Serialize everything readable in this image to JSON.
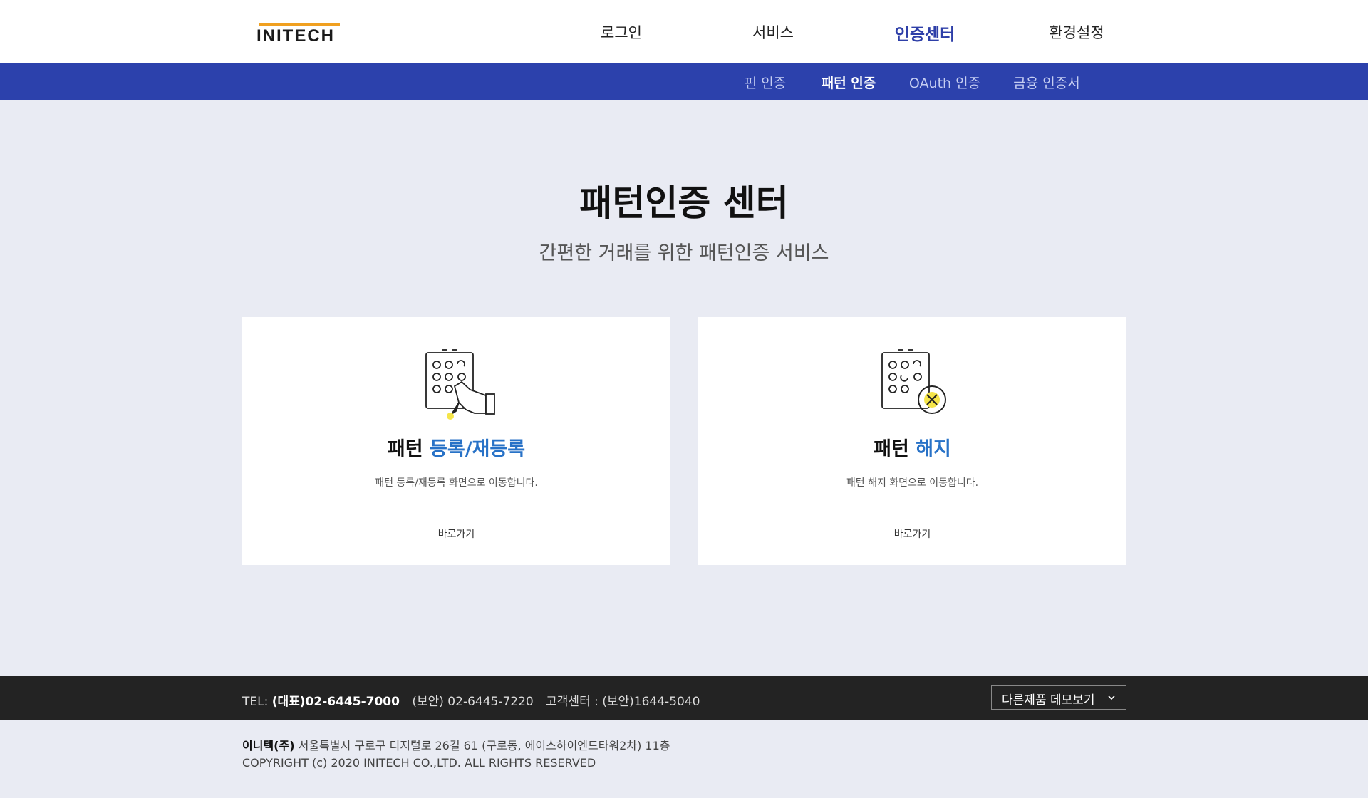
{
  "header": {
    "logo_text": "INITECH",
    "nav": [
      {
        "label": "로그인"
      },
      {
        "label": "서비스"
      },
      {
        "label": "인증센터",
        "active": true
      },
      {
        "label": "환경설정"
      }
    ]
  },
  "subnav": [
    {
      "label": "핀 인증"
    },
    {
      "label": "패턴 인증",
      "active": true
    },
    {
      "label": "OAuth 인증"
    },
    {
      "label": "금융 인증서"
    }
  ],
  "hero": {
    "title": "패턴인증 센터",
    "subtitle": "간편한 거래를 위한 패턴인증 서비스"
  },
  "cards": [
    {
      "title_prefix": "패턴",
      "title_accent": "등록/재등록",
      "description": "패턴 등록/재등록 화면으로 이동합니다.",
      "link": "바로가기",
      "icon": "pattern-register-icon"
    },
    {
      "title_prefix": "패턴",
      "title_accent": "해지",
      "description": "패턴 해지 화면으로 이동합니다.",
      "link": "바로가기",
      "icon": "pattern-cancel-icon"
    }
  ],
  "footer": {
    "tel_label": "TEL:",
    "tel_main": "(대표)02-6445-7000",
    "tel_security": "(보안) 02-6445-7220",
    "support": "고객센터 : (보안)1644-5040",
    "demo_select": "다른제품 데모보기",
    "company": "이니텍(주)",
    "address": "서울특별시 구로구 디지털로 26길 61 (구로동, 에이스하이엔드타워2차) 11층",
    "copyright": "COPYRIGHT (c) 2020 INITECH CO.,LTD. ALL RIGHTS RESERVED"
  },
  "colors": {
    "brand_blue": "#2c41ac",
    "accent_blue": "#2872c7",
    "logo_orange": "#f0a020",
    "highlight_yellow": "#f5e54a",
    "footer_dark": "#232323",
    "page_bg": "#e9ebf3"
  }
}
